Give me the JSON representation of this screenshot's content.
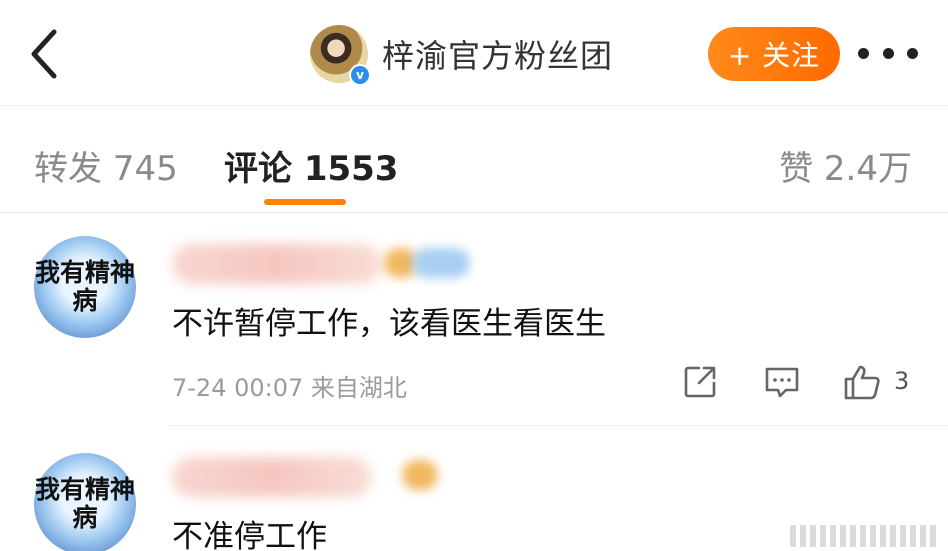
{
  "header": {
    "title": "梓渝官方粉丝团",
    "follow_label": "+ 关注",
    "verified_mark": "v"
  },
  "tabs": {
    "repost": "转发 745",
    "comments": "评论 1553",
    "likes": "赞 2.4万"
  },
  "comments": [
    {
      "avatar_text": "我有精神病",
      "text": "不许暂停工作，该看医生看医生",
      "meta": "7-24 00:07 来自湖北",
      "like_count": "3"
    },
    {
      "avatar_text": "我有精神病",
      "text": "不准停工作"
    }
  ],
  "colors": {
    "accent": "#ff8200",
    "verified": "#2a8ef0"
  },
  "icons": {
    "back": "back-arrow-icon",
    "more": "more-dots-icon",
    "share": "share-icon",
    "reply": "reply-icon",
    "like": "thumbs-up-icon"
  }
}
